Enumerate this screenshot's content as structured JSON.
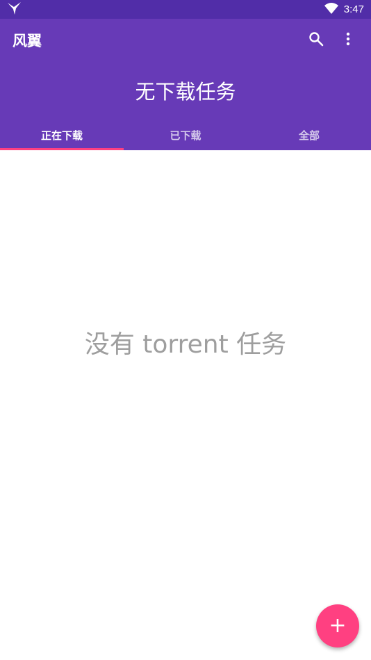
{
  "status_bar": {
    "time": "3:47",
    "icons": [
      "bird-notification-icon",
      "wifi-icon"
    ]
  },
  "toolbar": {
    "title": "风翼",
    "actions": [
      "search-icon",
      "more-vert-icon"
    ]
  },
  "header": {
    "title": "无下载任务"
  },
  "tabs": [
    {
      "label": "正在下载",
      "active": true
    },
    {
      "label": "已下载",
      "active": false
    },
    {
      "label": "全部",
      "active": false
    }
  ],
  "content": {
    "empty_message": "没有 torrent 任务"
  },
  "fab": {
    "label": "+",
    "icon": "add-icon"
  },
  "colors": {
    "status_bar": "#512da8",
    "primary": "#673ab7",
    "accent": "#ff4081",
    "empty_text": "#9e9e9e"
  }
}
